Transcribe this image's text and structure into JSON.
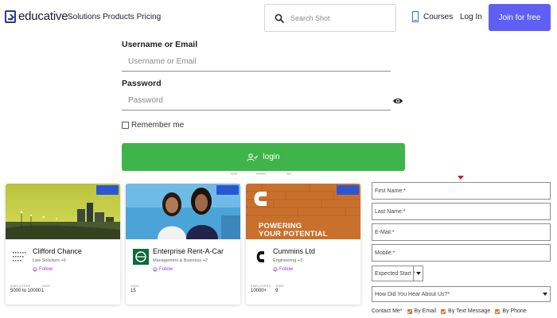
{
  "header": {
    "logo_text": "educative",
    "nav_links": [
      "Solutions",
      "Products",
      "Pricing"
    ],
    "search_placeholder": "Search Shot",
    "courses_label": "Courses",
    "login_label": "Log In",
    "join_label": "Join for free"
  },
  "login_form": {
    "username_label": "Username or Email",
    "username_placeholder": "Username or Email",
    "password_label": "Password",
    "password_placeholder": "Password",
    "remember_label": "Remember me",
    "remember_checked": false,
    "submit_label": "login"
  },
  "company_cards": [
    {
      "badge": "",
      "name": "Clifford Chance",
      "category": "Law Solicitors +9",
      "follow_label": "Follow",
      "stats": [
        {
          "label": "EMPLOYEES",
          "value": "5000 to 10000"
        },
        {
          "label": "JOBS",
          "value": "1"
        }
      ]
    },
    {
      "badge": "",
      "name": "Enterprise Rent-A-Car",
      "category": "Management & Business +2",
      "follow_label": "Follow",
      "stats": [
        {
          "label": "JOBS",
          "value": "15"
        }
      ]
    },
    {
      "badge": "",
      "name": "Cummins Ltd",
      "category": "Engineering +3",
      "follow_label": "Follow",
      "banner_text": [
        "POWERING",
        "YOUR POTENTIAL"
      ],
      "stats": [
        {
          "label": "EMPLOYEES",
          "value": "10000+"
        },
        {
          "label": "JOBS",
          "value": "9"
        }
      ]
    }
  ],
  "enquiry_form": {
    "first_name_placeholder": "First Name:*",
    "last_name_placeholder": "Last Name:*",
    "email_placeholder": "E-Mail:*",
    "mobile_placeholder": "Mobile:*",
    "expected_start": "Expected Start *",
    "heard_about": "How Did You Hear About Us?*",
    "contact_label": "Contact Me*",
    "contact_options": [
      {
        "label": "By Email",
        "checked": true
      },
      {
        "label": "By Text Message",
        "checked": true
      },
      {
        "label": "By Phone",
        "checked": true
      }
    ]
  },
  "colors": {
    "accent": "#5f5ff6",
    "login_button": "#3fb549",
    "follow": "#8a3fd6",
    "badge": "#2c55d6",
    "checkbox": "#e06a2a",
    "marker": "#c82020"
  },
  "icons": [
    "search-icon",
    "courses-icon",
    "eye-icon",
    "user-icon",
    "bell-icon",
    "chevron-down-icon"
  ]
}
